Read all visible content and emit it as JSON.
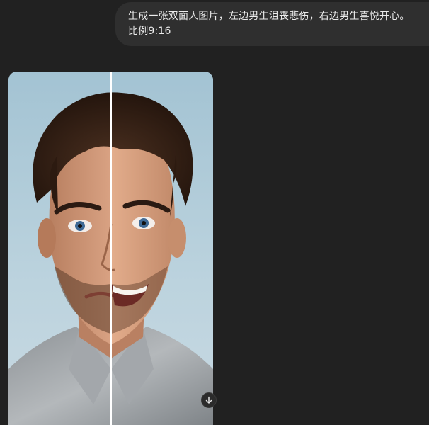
{
  "user_message": {
    "line1": "生成一张双面人图片，左边男生沮丧悲伤，右边男生喜悦开心。",
    "line2": "比例9:16"
  },
  "generated_image": {
    "subject": "split-face portrait: sad man on left, happy man on right",
    "aspect_ratio": "9:16"
  },
  "icons": {
    "download": "arrow-down-icon"
  },
  "colors": {
    "background": "#212121",
    "bubble": "#2f2f2f",
    "text": "#ececec",
    "image_sky": "#a9c4d2"
  }
}
